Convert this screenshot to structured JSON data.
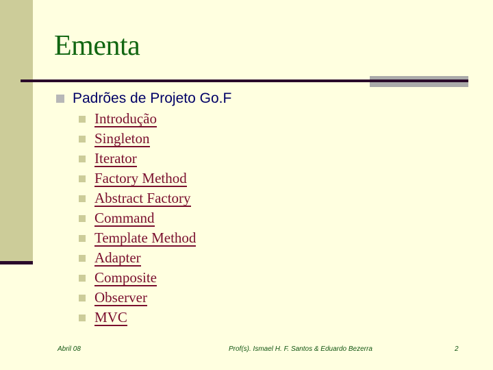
{
  "slide": {
    "title": "Ementa",
    "main_bullet": "Padrões de Projeto Go.F",
    "sub_items": [
      "Introdução",
      "Singleton",
      "Iterator",
      "Factory Method",
      "Abstract Factory",
      "Command",
      "Template Method",
      "Adapter",
      "Composite",
      "Observer",
      "MVC"
    ]
  },
  "footer": {
    "date": "Abril 08",
    "authors": "Prof(s). Ismael H. F. Santos & Eduardo Bezerra",
    "page_number": "2"
  },
  "colors": {
    "background": "#FFFFE0",
    "title": "#116611",
    "links": "#7A0F2E",
    "main_text": "#000066"
  }
}
